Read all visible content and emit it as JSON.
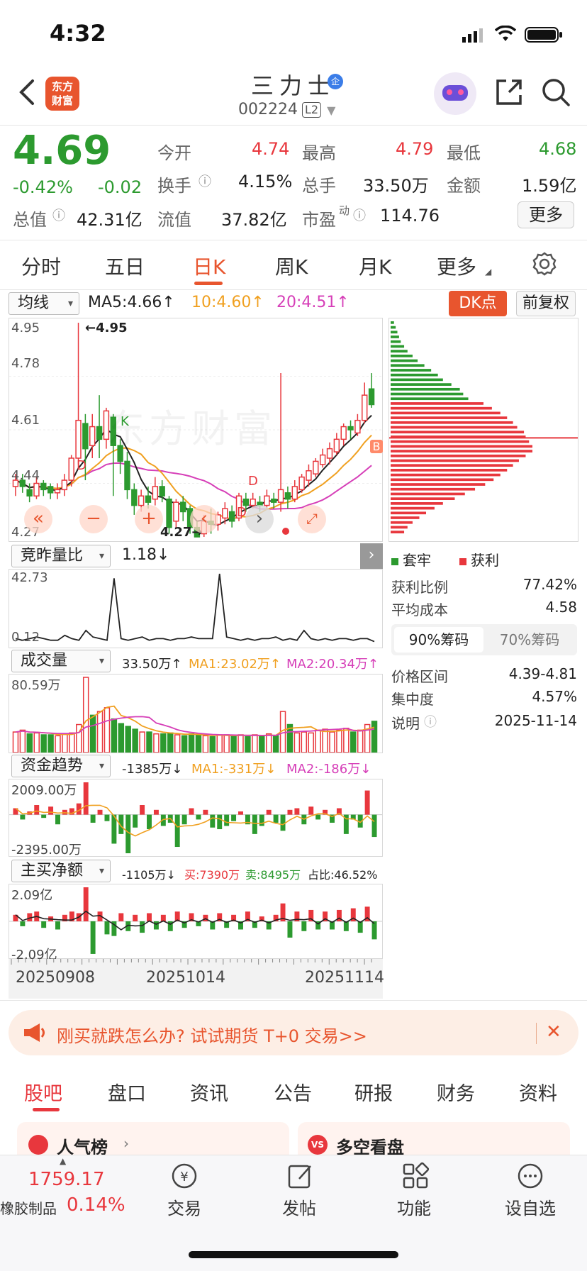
{
  "status_bar": {
    "time": "4:32"
  },
  "header": {
    "logo_line1": "东方",
    "logo_line2": "财富",
    "stock_name": "三力士",
    "badge": "企",
    "stock_code": "002224",
    "level": "L2"
  },
  "quote": {
    "price": "4.69",
    "change_pct": "-0.42%",
    "change": "-0.02",
    "fields": [
      {
        "label": "今开",
        "value": "4.74"
      },
      {
        "label": "最高",
        "value": "4.79"
      },
      {
        "label": "最低",
        "value": "4.68"
      },
      {
        "label": "换手",
        "value": "4.15%"
      },
      {
        "label": "总手",
        "value": "33.50万"
      },
      {
        "label": "金额",
        "value": "1.59亿"
      },
      {
        "label": "总值",
        "value": "42.31亿"
      },
      {
        "label": "流值",
        "value": "37.82亿"
      },
      {
        "label": "市盈",
        "sup": "动",
        "value": "114.76"
      }
    ],
    "more_label": "更多"
  },
  "period_tabs": [
    "分时",
    "五日",
    "日K",
    "周K",
    "月K",
    "更多"
  ],
  "kline": {
    "indicator_select": "均线",
    "ma5": "MA5:4.66↑",
    "ma10": "10:4.60↑",
    "ma20": "20:4.51↑",
    "dk_label": "DK点",
    "fq_label": "前复权",
    "y_labels": [
      "4.95",
      "4.78",
      "4.61",
      "4.44",
      "4.27"
    ],
    "high_note": "←4.95",
    "low_note": "4.27→",
    "marks": [
      "K",
      "D",
      "D",
      "D",
      "B"
    ],
    "watermark": "东方财富"
  },
  "jzlb": {
    "select": "竞昨量比",
    "value": "1.18↓",
    "y_top": "42.73",
    "y_bottom": "0.12"
  },
  "volume": {
    "select": "成交量",
    "value": "33.50万↑",
    "ma1": "MA1:23.02万↑",
    "ma2": "MA2:20.34万↑",
    "y_top": "80.59万"
  },
  "fund_trend": {
    "select": "资金趋势",
    "value": "-1385万↓",
    "ma1": "MA1:-331万↓",
    "ma2": "MA2:-186万↓",
    "y_top": "2009.00万",
    "y_bottom": "-2395.00万"
  },
  "net_buy": {
    "select": "主买净额",
    "value": "-1105万↓",
    "buy": "买:7390万",
    "sell": "卖:8495万",
    "ratio": "占比:46.52%",
    "y_top": "2.09亿",
    "y_bottom": "-2.09亿"
  },
  "x_dates": [
    "20250908",
    "20251014",
    "20251114"
  ],
  "chip_panel": {
    "legend_trapped": "套牢",
    "legend_profit": "获利",
    "rows1": [
      {
        "label": "获利比例",
        "value": "77.42%"
      },
      {
        "label": "平均成本",
        "value": "4.58"
      }
    ],
    "tabs": [
      "90%筹码",
      "70%筹码"
    ],
    "rows2": [
      {
        "label": "价格区间",
        "value": "4.39-4.81"
      },
      {
        "label": "集中度",
        "value": "4.57%"
      },
      {
        "label": "说明",
        "value": "2025-11-14"
      }
    ]
  },
  "ad": {
    "text": "刚买就跌怎么办? 试试期货 T+0 交易>>"
  },
  "content_tabs": [
    "股吧",
    "盘口",
    "资讯",
    "公告",
    "研报",
    "财务",
    "资料"
  ],
  "cards": [
    {
      "title": "人气榜"
    },
    {
      "title": "多空看盘"
    }
  ],
  "bottom_bar": {
    "index_value": "1759.17",
    "index_name": "橡胶制品",
    "index_change": "0.14%",
    "items": [
      "交易",
      "发帖",
      "功能",
      "设自选"
    ]
  },
  "colors": {
    "up": "#e8373d",
    "down": "#2c9a2f",
    "brand": "#e8552e",
    "ma10": "#f0a020",
    "ma20": "#d63fb8"
  },
  "chart_data": [
    {
      "type": "candlestick",
      "title": "",
      "ylim": [
        4.27,
        4.95
      ],
      "candles": [
        [
          4.43,
          4.45,
          4.4,
          4.47
        ],
        [
          4.45,
          4.43,
          4.41,
          4.47
        ],
        [
          4.42,
          4.4,
          4.38,
          4.44
        ],
        [
          4.4,
          4.44,
          4.39,
          4.46
        ],
        [
          4.44,
          4.42,
          4.4,
          4.45
        ],
        [
          4.43,
          4.41,
          4.39,
          4.44
        ],
        [
          4.41,
          4.42,
          4.39,
          4.44
        ],
        [
          4.42,
          4.45,
          4.4,
          4.47
        ],
        [
          4.45,
          4.52,
          4.43,
          4.53
        ],
        [
          4.52,
          4.64,
          4.5,
          4.95
        ],
        [
          4.63,
          4.55,
          4.45,
          4.66
        ],
        [
          4.56,
          4.62,
          4.52,
          4.66
        ],
        [
          4.62,
          4.58,
          4.52,
          4.72
        ],
        [
          4.58,
          4.67,
          4.55,
          4.68
        ],
        [
          4.65,
          4.56,
          4.4,
          4.66
        ],
        [
          4.56,
          4.51,
          4.47,
          4.58
        ],
        [
          4.51,
          4.42,
          4.39,
          4.54
        ],
        [
          4.42,
          4.37,
          4.34,
          4.44
        ],
        [
          4.37,
          4.4,
          4.35,
          4.42
        ],
        [
          4.4,
          4.38,
          4.36,
          4.43
        ],
        [
          4.39,
          4.43,
          4.37,
          4.46
        ],
        [
          4.43,
          4.4,
          4.38,
          4.45
        ],
        [
          4.39,
          4.3,
          4.28,
          4.4
        ],
        [
          4.32,
          4.38,
          4.3,
          4.39
        ],
        [
          4.38,
          4.35,
          4.32,
          4.4
        ],
        [
          4.36,
          4.3,
          4.28,
          4.37
        ],
        [
          4.3,
          4.27,
          4.27,
          4.32
        ],
        [
          4.28,
          4.32,
          4.27,
          4.34
        ],
        [
          4.32,
          4.31,
          4.28,
          4.36
        ],
        [
          4.31,
          4.34,
          4.29,
          4.35
        ],
        [
          4.33,
          4.36,
          4.31,
          4.38
        ],
        [
          4.35,
          4.32,
          4.3,
          4.37
        ],
        [
          4.33,
          4.4,
          4.32,
          4.41
        ],
        [
          4.39,
          4.37,
          4.35,
          4.41
        ],
        [
          4.37,
          4.39,
          4.36,
          4.41
        ],
        [
          4.38,
          4.37,
          4.35,
          4.4
        ],
        [
          4.37,
          4.4,
          4.36,
          4.42
        ],
        [
          4.39,
          4.38,
          4.36,
          4.41
        ],
        [
          4.38,
          4.42,
          4.35,
          4.79
        ],
        [
          4.41,
          4.39,
          4.36,
          4.43
        ],
        [
          4.39,
          4.43,
          4.38,
          4.45
        ],
        [
          4.42,
          4.46,
          4.41,
          4.47
        ],
        [
          4.45,
          4.48,
          4.43,
          4.5
        ],
        [
          4.47,
          4.51,
          4.46,
          4.52
        ],
        [
          4.5,
          4.53,
          4.49,
          4.55
        ],
        [
          4.52,
          4.55,
          4.5,
          4.57
        ],
        [
          4.54,
          4.58,
          4.53,
          4.6
        ],
        [
          4.58,
          4.62,
          4.56,
          4.63
        ],
        [
          4.62,
          4.61,
          4.58,
          4.64
        ],
        [
          4.6,
          4.64,
          4.59,
          4.66
        ],
        [
          4.64,
          4.72,
          4.63,
          4.76
        ],
        [
          4.74,
          4.69,
          4.68,
          4.79
        ]
      ],
      "ma5_last": 4.66,
      "ma10_last": 4.6,
      "ma20_last": 4.51
    },
    {
      "type": "line",
      "title": "",
      "series": [
        {
          "values": [
            3,
            2,
            3,
            4,
            3,
            2,
            2,
            5,
            3,
            2,
            8,
            4,
            3,
            2,
            40,
            3,
            2,
            3,
            4,
            2,
            3,
            3,
            2,
            3,
            3,
            4,
            3,
            3,
            3,
            42.73,
            4,
            3,
            2,
            3,
            2,
            3,
            3,
            4,
            2,
            3,
            2,
            8,
            3,
            2,
            3,
            2,
            3,
            3,
            2,
            3,
            3,
            1.18
          ]
        }
      ],
      "ylim": [
        0.12,
        42.73
      ]
    },
    {
      "type": "bar",
      "title": "",
      "values": [
        22,
        24,
        20,
        21,
        19,
        19,
        18,
        20,
        21,
        30,
        80.59,
        40,
        44,
        48,
        36,
        31,
        28,
        25,
        22,
        22,
        20,
        20,
        21,
        19,
        18,
        20,
        19,
        18,
        17,
        19,
        19,
        18,
        19,
        17,
        19,
        18,
        20,
        18,
        44,
        30,
        21,
        22,
        21,
        24,
        25,
        22,
        24,
        26,
        22,
        24,
        30,
        33.5
      ],
      "up": [
        1,
        1,
        0,
        1,
        0,
        0,
        1,
        1,
        1,
        1,
        1,
        0,
        1,
        1,
        0,
        0,
        0,
        0,
        1,
        0,
        1,
        0,
        0,
        1,
        0,
        0,
        0,
        1,
        0,
        1,
        1,
        0,
        1,
        0,
        1,
        0,
        1,
        0,
        1,
        0,
        1,
        1,
        1,
        1,
        1,
        1,
        1,
        1,
        0,
        1,
        1,
        0
      ],
      "ylim": [
        0,
        80.59
      ]
    },
    {
      "type": "bar",
      "title": "",
      "values": [
        400,
        -300,
        200,
        600,
        -200,
        500,
        -600,
        300,
        400,
        700,
        2009,
        -500,
        300,
        -400,
        -1800,
        -1200,
        -2395,
        -800,
        600,
        -900,
        300,
        -700,
        -500,
        -2000,
        -600,
        400,
        -300,
        300,
        -800,
        -900,
        -700,
        -400,
        200,
        -600,
        -1200,
        -700,
        300,
        -500,
        -1000,
        300,
        400,
        -600,
        500,
        -300,
        300,
        -500,
        400,
        -1200,
        -300,
        -800,
        1500,
        -1385
      ],
      "ylim": [
        -2395,
        2009
      ]
    },
    {
      "type": "bar",
      "title": "",
      "values": [
        0.4,
        -0.3,
        0.5,
        0.6,
        -0.4,
        0.3,
        -0.5,
        0.4,
        0.6,
        0.5,
        2.09,
        -2.0,
        0.6,
        -0.8,
        -0.9,
        0.5,
        -0.6,
        0.4,
        -0.7,
        0.5,
        -0.5,
        0.4,
        -0.6,
        0.6,
        -0.4,
        0.5,
        -0.3,
        0.4,
        -0.5,
        0.5,
        -0.4,
        0.4,
        -0.5,
        0.6,
        -0.4,
        0.3,
        -0.5,
        0.4,
        1.1,
        -1.0,
        0.6,
        -0.6,
        0.7,
        -0.5,
        0.6,
        -0.5,
        0.7,
        -0.6,
        0.8,
        -0.7,
        0.9,
        -1.105
      ],
      "ylim": [
        -2.09,
        2.09
      ]
    },
    {
      "type": "bar",
      "title": "",
      "price_range": [
        4.27,
        4.95
      ],
      "trapped_above": 4.69,
      "avg_cost_marker": 4.58,
      "values": [
        4,
        6,
        8,
        10,
        12,
        16,
        20,
        26,
        32,
        40,
        48,
        56,
        62,
        72,
        82,
        86,
        92,
        110,
        120,
        130,
        138,
        145,
        150,
        158,
        160,
        164,
        168,
        168,
        160,
        152,
        145,
        138,
        130,
        122,
        112,
        100,
        88,
        76,
        62,
        52,
        42,
        34,
        26,
        20,
        16
      ]
    }
  ]
}
